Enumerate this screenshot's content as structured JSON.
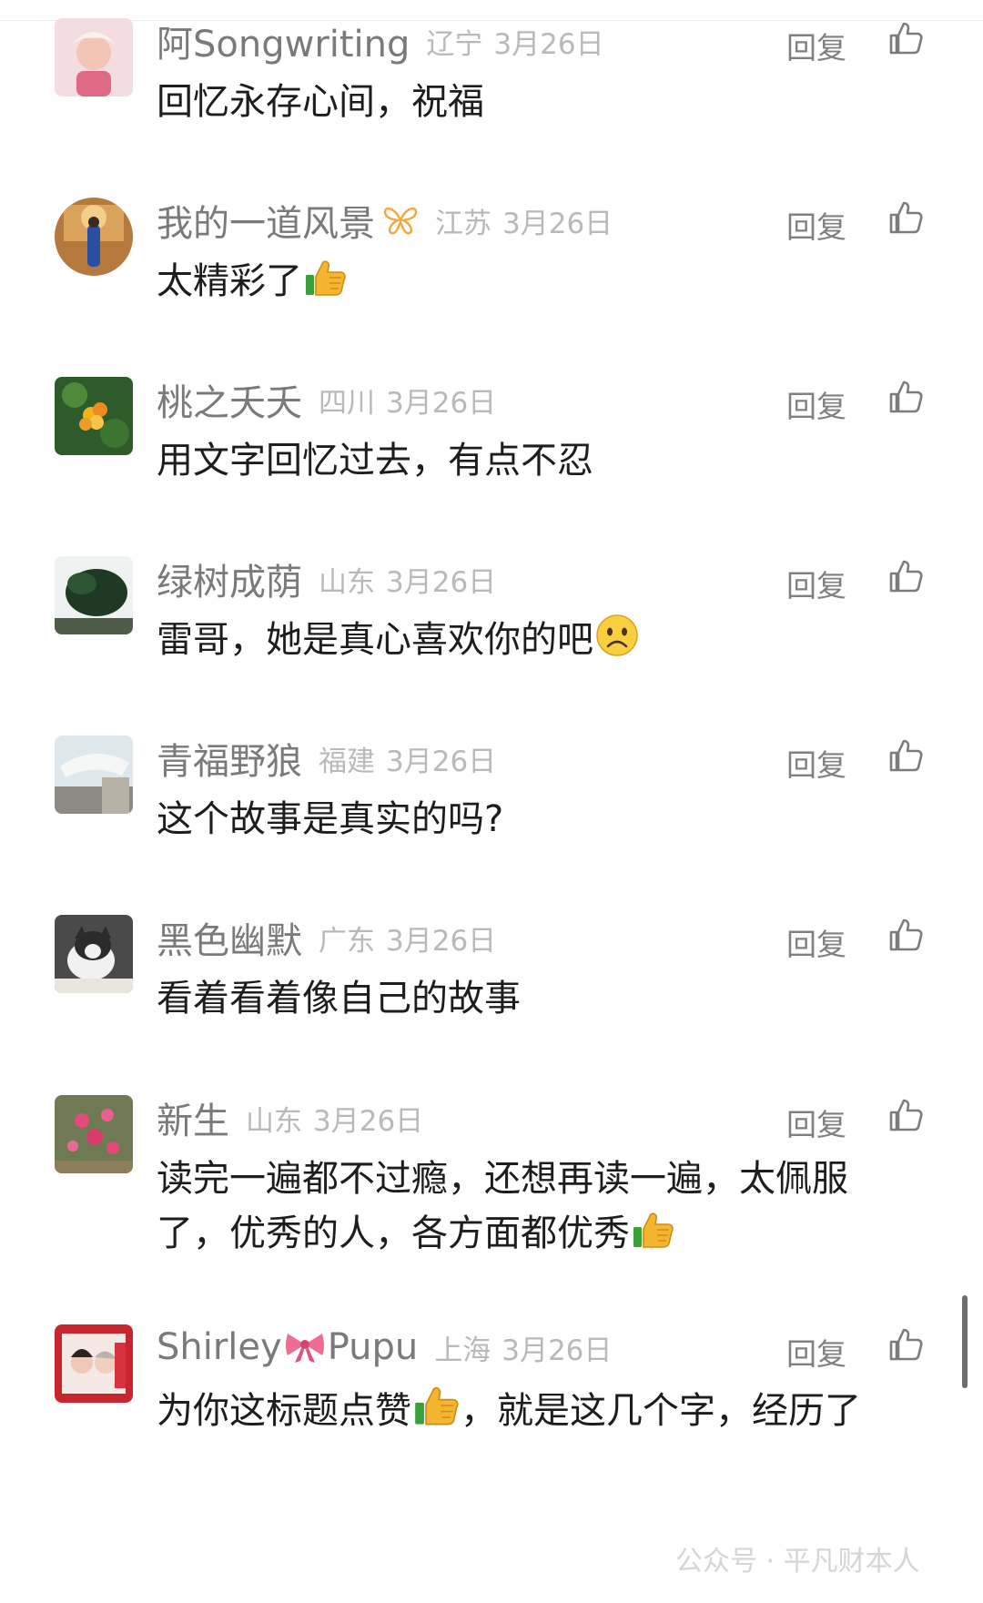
{
  "reply_label": "回复",
  "comments": [
    {
      "user": "阿Songwriting",
      "region": "辽宁",
      "date": "3月26日",
      "text": "回忆永存心间，祝福"
    },
    {
      "user": "我的一道风景",
      "badge": "butterfly-badge-icon",
      "region": "江苏",
      "date": "3月26日",
      "text": "太精彩了",
      "emoji": "thumbs-up-emoji"
    },
    {
      "user": "桃之夭夭",
      "region": "四川",
      "date": "3月26日",
      "text": "用文字回忆过去，有点不忍"
    },
    {
      "user": "绿树成荫",
      "region": "山东",
      "date": "3月26日",
      "text": "雷哥，她是真心喜欢你的吧",
      "emoji": "frowning-face-emoji"
    },
    {
      "user": "青福野狼",
      "region": "福建",
      "date": "3月26日",
      "text": "这个故事是真实的吗?"
    },
    {
      "user": "黑色幽默",
      "region": "广东",
      "date": "3月26日",
      "text": "看着看着像自己的故事"
    },
    {
      "user": "新生",
      "region": "山东",
      "date": "3月26日",
      "text_line1": "读完一遍都不过瘾，还想再读一遍，太佩服",
      "text_line2": "了，优秀的人，各方面都优秀",
      "emoji": "thumbs-up-emoji"
    },
    {
      "user_part1": "Shirley",
      "user_part2": "Pupu",
      "badge": "ribbon-bow-icon",
      "region": "上海",
      "date": "3月26日",
      "text_part1": "为你这标题点赞",
      "text_part2": "，就是这几个字，经历了",
      "emoji": "thumbs-up-emoji"
    }
  ],
  "watermark": "公众号 · 平凡财本人",
  "colors": {
    "username": "#7a7a7a",
    "meta": "#b9b9b9",
    "body_text": "#1d1d1d",
    "action": "#808080"
  }
}
